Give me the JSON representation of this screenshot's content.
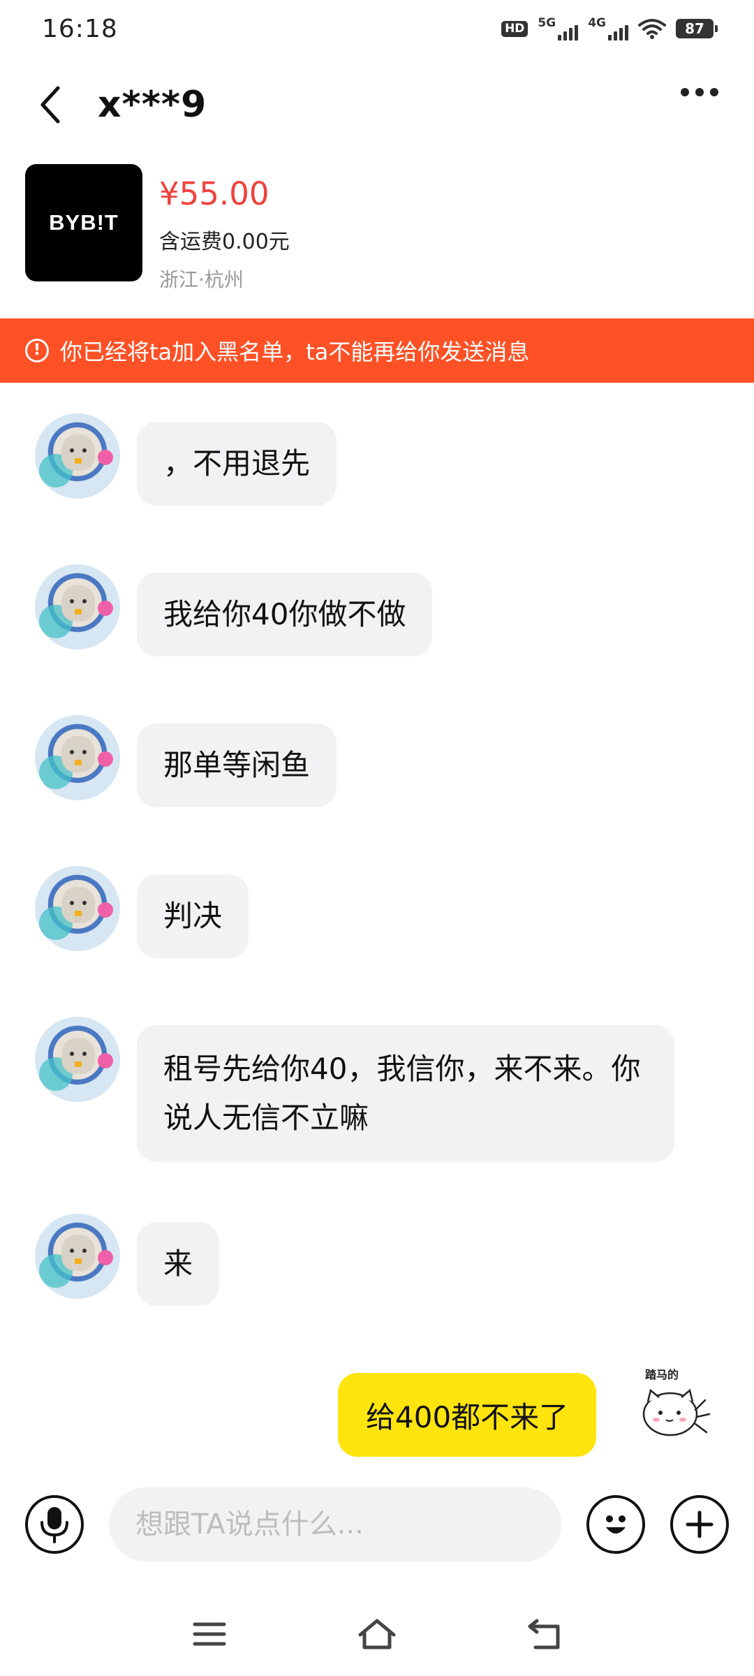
{
  "status_bar": {
    "time": "16:18",
    "hd": "HD",
    "network1": "5G",
    "network2": "4G",
    "battery": "87"
  },
  "header": {
    "title": "x***9",
    "back_icon": "chevron-left-icon",
    "more_icon": "more-dots-icon"
  },
  "product": {
    "brand": "BYB!T",
    "price": "¥55.00",
    "shipping": "含运费0.00元",
    "location": "浙江·杭州"
  },
  "banner": {
    "icon": "!",
    "text": "你已经将ta加入黑名单，ta不能再给你发送消息",
    "color": "#ff5126"
  },
  "messages": [
    {
      "from": "other",
      "text": "，不用退先"
    },
    {
      "from": "other",
      "text": "我给你40你做不做"
    },
    {
      "from": "other",
      "text": "那单等闲鱼"
    },
    {
      "from": "other",
      "text": "判决"
    },
    {
      "from": "other",
      "text": "租号先给你40，我信你，来不来。你说人无信不立嘛"
    },
    {
      "from": "other",
      "text": "来"
    },
    {
      "from": "self",
      "text": "给400都不来了"
    }
  ],
  "self_avatar_label": "踏马的",
  "input": {
    "placeholder": "想跟TA说点什么...",
    "voice_icon": "microphone-icon",
    "emoji_icon": "emoji-icon",
    "plus_icon": "plus-icon"
  },
  "colors": {
    "price": "#f0413e",
    "self_bubble": "#ffe40d",
    "other_bubble": "#f2f2f4"
  }
}
